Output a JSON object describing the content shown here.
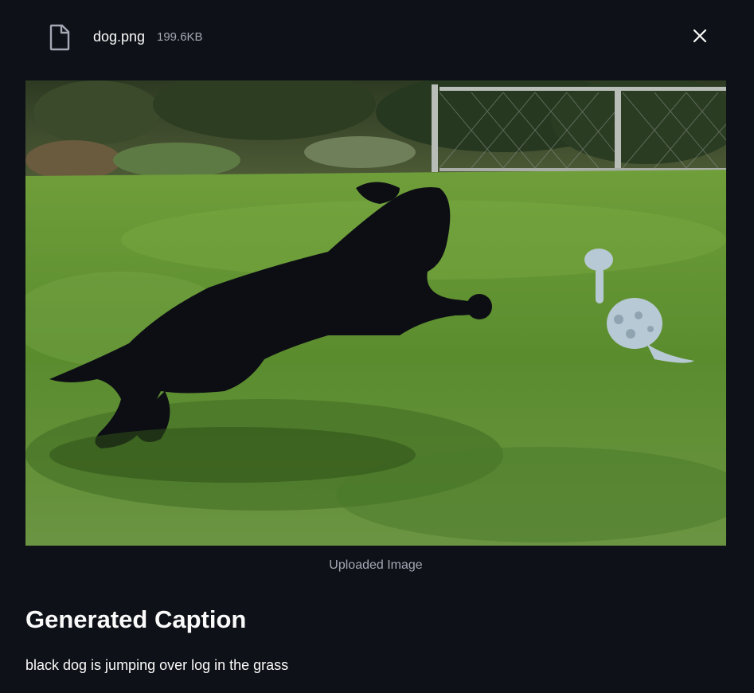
{
  "file": {
    "name": "dog.png",
    "size": "199.6KB",
    "icon": "file-icon",
    "close_icon": "close-icon"
  },
  "image": {
    "caption": "Uploaded Image"
  },
  "result": {
    "heading": "Generated Caption",
    "caption": "black dog is jumping over log in the grass"
  },
  "colors": {
    "background": "#0e1117",
    "text": "#fafafa",
    "muted_text": "#a3a8b4"
  }
}
